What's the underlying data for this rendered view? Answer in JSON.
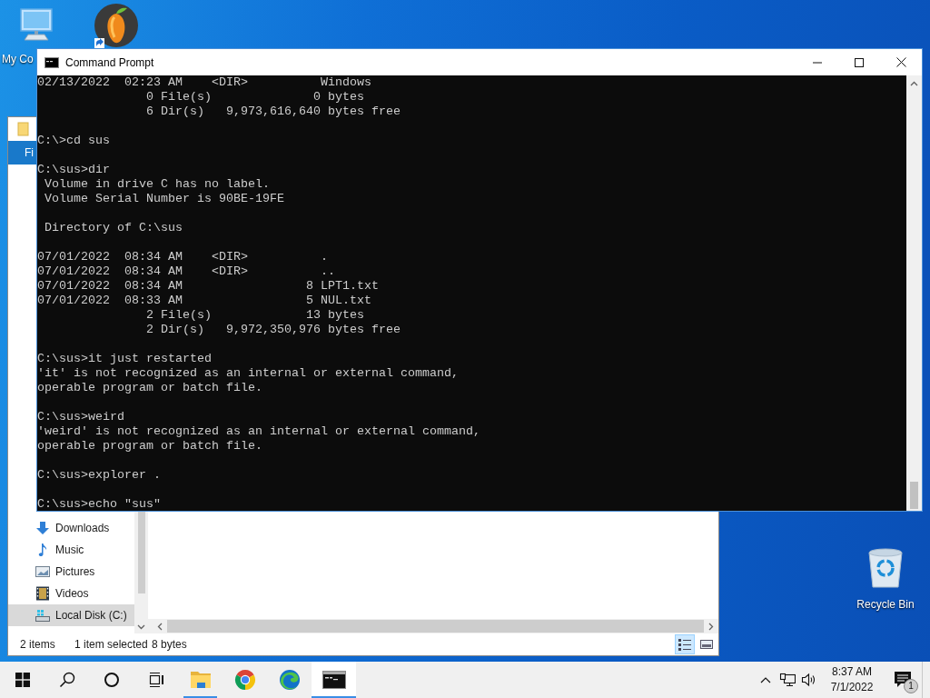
{
  "desktop": {
    "icons": [
      {
        "kind": "computer",
        "label": "My Co"
      },
      {
        "kind": "app"
      },
      {
        "kind": "recycle",
        "label": "Recycle Bin"
      }
    ]
  },
  "explorer": {
    "file_tab": "Fi",
    "nav_items": [
      {
        "kind": "downloads",
        "label": "Downloads",
        "selected": false
      },
      {
        "kind": "music",
        "label": "Music",
        "selected": false
      },
      {
        "kind": "pictures",
        "label": "Pictures",
        "selected": false
      },
      {
        "kind": "videos",
        "label": "Videos",
        "selected": false
      },
      {
        "kind": "disk",
        "label": "Local Disk (C:)",
        "selected": true
      }
    ],
    "status_bar": {
      "item_count": "2 items",
      "selection": "1 item selected",
      "size": "8 bytes"
    },
    "views": [
      {
        "kind": "details",
        "selected": true
      },
      {
        "kind": "preview",
        "selected": false
      }
    ]
  },
  "console": {
    "title": "Command Prompt",
    "blocks": [
      [
        "02/13/2022  02:23 AM    <DIR>          Windows",
        "               0 File(s)              0 bytes",
        "               6 Dir(s)   9,973,616,640 bytes free"
      ],
      [
        "C:\\>cd sus"
      ],
      [
        "C:\\sus>dir",
        " Volume in drive C has no label.",
        " Volume Serial Number is 90BE-19FE"
      ],
      [
        " Directory of C:\\sus"
      ],
      [
        "07/01/2022  08:34 AM    <DIR>          .",
        "07/01/2022  08:34 AM    <DIR>          ..",
        "07/01/2022  08:34 AM                 8 LPT1.txt",
        "07/01/2022  08:33 AM                 5 NUL.txt",
        "               2 File(s)             13 bytes",
        "               2 Dir(s)   9,972,350,976 bytes free"
      ],
      [
        "C:\\sus>it just restarted",
        "'it' is not recognized as an internal or external command,",
        "operable program or batch file."
      ],
      [
        "C:\\sus>weird",
        "'weird' is not recognized as an internal or external command,",
        "operable program or batch file."
      ],
      [
        "C:\\sus>explorer ."
      ],
      [
        "C:\\sus>echo \"sus\""
      ]
    ]
  },
  "taskbar": {
    "buttons": [
      {
        "kind": "start",
        "running": false,
        "selected": false
      },
      {
        "kind": "search",
        "running": false,
        "selected": false
      },
      {
        "kind": "cortana",
        "running": false,
        "selected": false
      },
      {
        "kind": "taskview",
        "running": false,
        "selected": false
      },
      {
        "kind": "folder",
        "running": true,
        "selected": false
      },
      {
        "kind": "browser",
        "running": false,
        "selected": false
      },
      {
        "kind": "edge",
        "running": false,
        "selected": false
      },
      {
        "kind": "console",
        "running": true,
        "selected": true
      }
    ],
    "clock": {
      "time": "8:37 AM",
      "date": "7/1/2022"
    },
    "notifications": {
      "count": "1"
    }
  }
}
